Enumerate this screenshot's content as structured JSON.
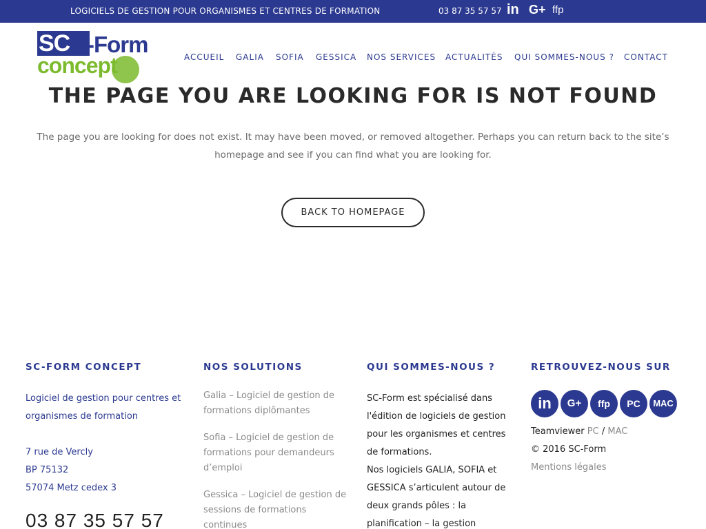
{
  "topbar": {
    "tagline": "LOGICIELS DE GESTION POUR ORGANISMES ET CENTRES DE FORMATION",
    "phone": "03 87 35 57 57",
    "social": [
      {
        "icon": "linkedin-icon",
        "glyph": "in"
      },
      {
        "icon": "google-plus-icon",
        "glyph": "G+"
      },
      {
        "icon": "ffp-icon",
        "glyph": "ffp"
      }
    ]
  },
  "logo": {
    "part1": "SC",
    "part2": "-Form",
    "part3": "concept"
  },
  "nav": {
    "items": [
      "ACCUEIL",
      "GALIA",
      "SOFIA",
      "GESSICA",
      "NOS SERVICES",
      "ACTUALITÉS",
      "QUI SOMMES-NOUS ?",
      "CONTACT"
    ]
  },
  "main": {
    "title": "THE PAGE YOU ARE LOOKING FOR IS NOT FOUND",
    "description": "The page you are looking for does not exist. It may have been moved, or removed altogether. Perhaps you can return back to the site’s homepage and see if you can find what you are looking for.",
    "button": "BACK TO HOMEPAGE"
  },
  "footer": {
    "col1": {
      "heading": "SC-FORM CONCEPT",
      "line1": "Logiciel de gestion pour centres et",
      "line2": "organismes de formation",
      "addr1": "7 rue de Vercly",
      "addr2": "BP 75132",
      "addr3": "57074 Metz cedex 3",
      "phone": "03 87 35 57 57"
    },
    "col2": {
      "heading": "NOS SOLUTIONS",
      "links": [
        [
          "Galia – Logiciel de gestion de",
          "formations diplômantes"
        ],
        [
          "Sofia – Logiciel de gestion de",
          "formations pour demandeurs",
          "d’emploi"
        ],
        [
          "Gessica – Logiciel de gestion de",
          "sessions de formations",
          "continues"
        ]
      ]
    },
    "col3": {
      "heading": "QUI SOMMES-NOUS ?",
      "lines": [
        "SC-Form est spécialisé dans",
        "l'édition de logiciels de gestion",
        "pour les organismes et centres",
        "de formations.",
        "Nos logiciels GALIA, SOFIA et",
        "GESSICA s’articulent autour de",
        "deux grands pôles : la",
        "planification – la gestion"
      ]
    },
    "col4": {
      "heading": "RETROUVEZ-NOUS SUR",
      "badges": [
        {
          "icon": "linkedin-icon",
          "label": "in"
        },
        {
          "icon": "google-plus-icon",
          "label": "G+"
        },
        {
          "icon": "ffp-icon",
          "label": "ffp"
        },
        {
          "icon": "pc-icon",
          "label": "PC"
        },
        {
          "icon": "mac-icon",
          "label": "MAC"
        }
      ],
      "teamviewer": "Teamviewer",
      "pc": "PC",
      "sep": "/",
      "mac": "MAC",
      "copyright": "© 2016 SC-Form",
      "legal": "Mentions légales"
    }
  },
  "colors": {
    "brand_blue": "#2b3990",
    "brand_green": "#7dbb2e"
  }
}
